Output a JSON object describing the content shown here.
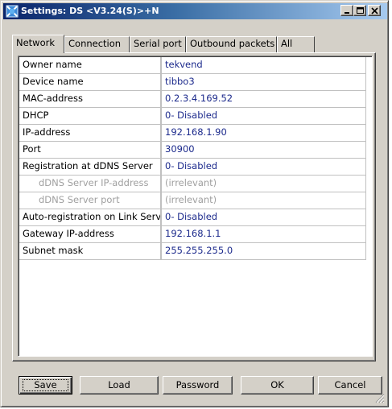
{
  "window": {
    "title": "Settings: DS <V3.24(S)>+N"
  },
  "tabs": [
    {
      "label": "Network",
      "active": true
    },
    {
      "label": "Connection",
      "active": false
    },
    {
      "label": "Serial port",
      "active": false
    },
    {
      "label": "Outbound packets",
      "active": false
    },
    {
      "label": "All",
      "active": false
    }
  ],
  "settings": [
    {
      "name": "Owner name",
      "value": "tekvend"
    },
    {
      "name": "Device name",
      "value": "tibbo3"
    },
    {
      "name": "MAC-address",
      "value": "0.2.3.4.169.52"
    },
    {
      "name": "DHCP",
      "value": "0- Disabled"
    },
    {
      "name": "IP-address",
      "value": "192.168.1.90"
    },
    {
      "name": "Port",
      "value": "30900"
    },
    {
      "name": "Registration at dDNS Server",
      "value": "0- Disabled"
    },
    {
      "name": "dDNS Server IP-address",
      "value": "(irrelevant)"
    },
    {
      "name": "dDNS Server port",
      "value": "(irrelevant)"
    },
    {
      "name": "Auto-registration on Link Serv",
      "value": "0- Disabled"
    },
    {
      "name": "Gateway IP-address",
      "value": "192.168.1.1"
    },
    {
      "name": "Subnet mask",
      "value": "255.255.255.0"
    }
  ],
  "buttons": {
    "save": "Save",
    "load": "Load",
    "password": "Password",
    "ok": "OK",
    "cancel": "Cancel"
  },
  "colors": {
    "title_gradient_start": "#0a246a",
    "title_gradient_end": "#a6caf0",
    "value_text": "#1c2a8c",
    "irrelevant_text": "#a0a0a0",
    "face": "#d4d0c8"
  },
  "icons": {
    "title": "settings-app-icon",
    "minimize": "minimize-icon",
    "maximize": "maximize-icon",
    "close": "close-icon",
    "resize": "resize-grip-icon"
  }
}
